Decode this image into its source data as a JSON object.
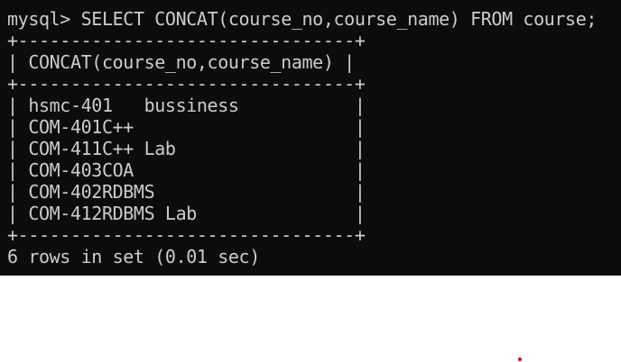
{
  "terminal": {
    "prompt": "mysql> ",
    "command": "SELECT CONCAT(course_no,course_name) FROM course;",
    "border_top": "+--------------------------------+",
    "header": "| CONCAT(course_no,course_name) |",
    "border_mid": "+--------------------------------+",
    "rows": [
      "| hsmc-401   bussiness           |",
      "| COM-401C++                     |",
      "| COM-411C++ Lab                 |",
      "| COM-403COA                     |",
      "| COM-402RDBMS                   |",
      "| COM-412RDBMS Lab               |"
    ],
    "border_bottom": "+--------------------------------+",
    "result_summary": "6 rows in set (0.01 sec)"
  },
  "colors": {
    "terminal_background": "#0c0c0c",
    "terminal_text": "#cccccc",
    "marker_dot": "#e00000"
  }
}
